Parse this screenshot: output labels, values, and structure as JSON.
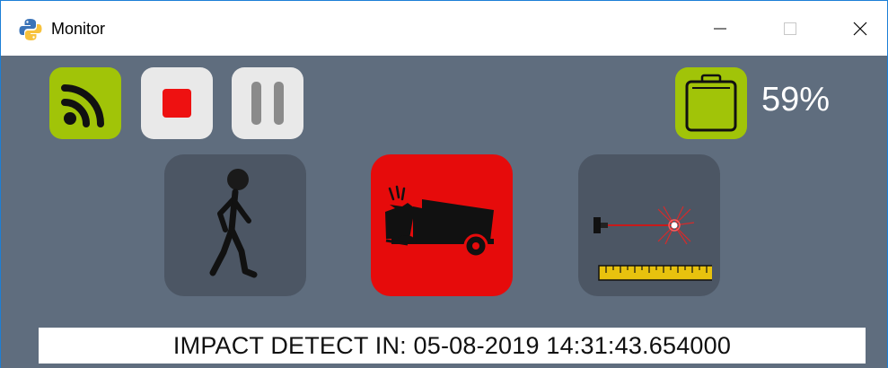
{
  "window": {
    "title": "Monitor"
  },
  "toolbar": {
    "connection_icon": "wifi-signal-icon",
    "record_icon": "stop-icon",
    "pause_icon": "pause-icon"
  },
  "battery": {
    "icon": "battery-icon",
    "percent": "59%",
    "level": 0.59
  },
  "status_icons": [
    {
      "name": "pedestrian-walking-icon",
      "active": false
    },
    {
      "name": "truck-impact-icon",
      "active": true
    },
    {
      "name": "laser-distance-icon",
      "active": false
    }
  ],
  "banner": {
    "text": "IMPACT DETECT IN: 05-08-2019 14:31:43.654000"
  },
  "colors": {
    "background": "#5f6d7e",
    "accent_green": "#a1c408",
    "alert_red": "#e60b0b",
    "inactive_tile": "#4c5664"
  }
}
